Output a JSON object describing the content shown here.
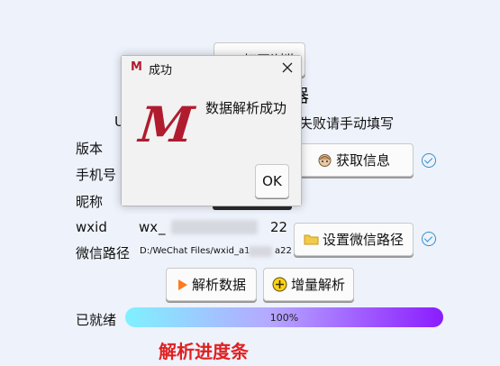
{
  "main": {
    "top_button_partial": "打开浏览",
    "heading_partial": "器",
    "hint_left": "U",
    "hint_right": "失败请手动填写",
    "fields": {
      "version_label": "版本",
      "phone_label": "手机号",
      "nickname_label": "昵称",
      "wxid_label": "wxid",
      "wxid_value_prefix": "wx",
      "wxid_value_mid": "_",
      "wxid_value_suffix": "22",
      "path_label": "微信路径",
      "path_value_prefix": "D:/WeChat Files/wxid_a1",
      "path_value_suffix": "a22"
    },
    "buttons": {
      "get_info": "获取信息",
      "set_path": "设置微信路径",
      "parse": "解析数据",
      "incremental": "增量解析"
    },
    "status": {
      "label": "已就绪",
      "progress_percent": 100,
      "progress_text": "100%"
    },
    "progress_caption": "解析进度条",
    "colors": {
      "accent_blue": "#2f8fd1",
      "caption_red": "#e02020",
      "logo_red": "#b01c2e"
    }
  },
  "dialog": {
    "title": "成功",
    "message": "数据解析成功",
    "ok_label": "OK",
    "logo_letter": "M",
    "close_icon": "close-icon"
  }
}
